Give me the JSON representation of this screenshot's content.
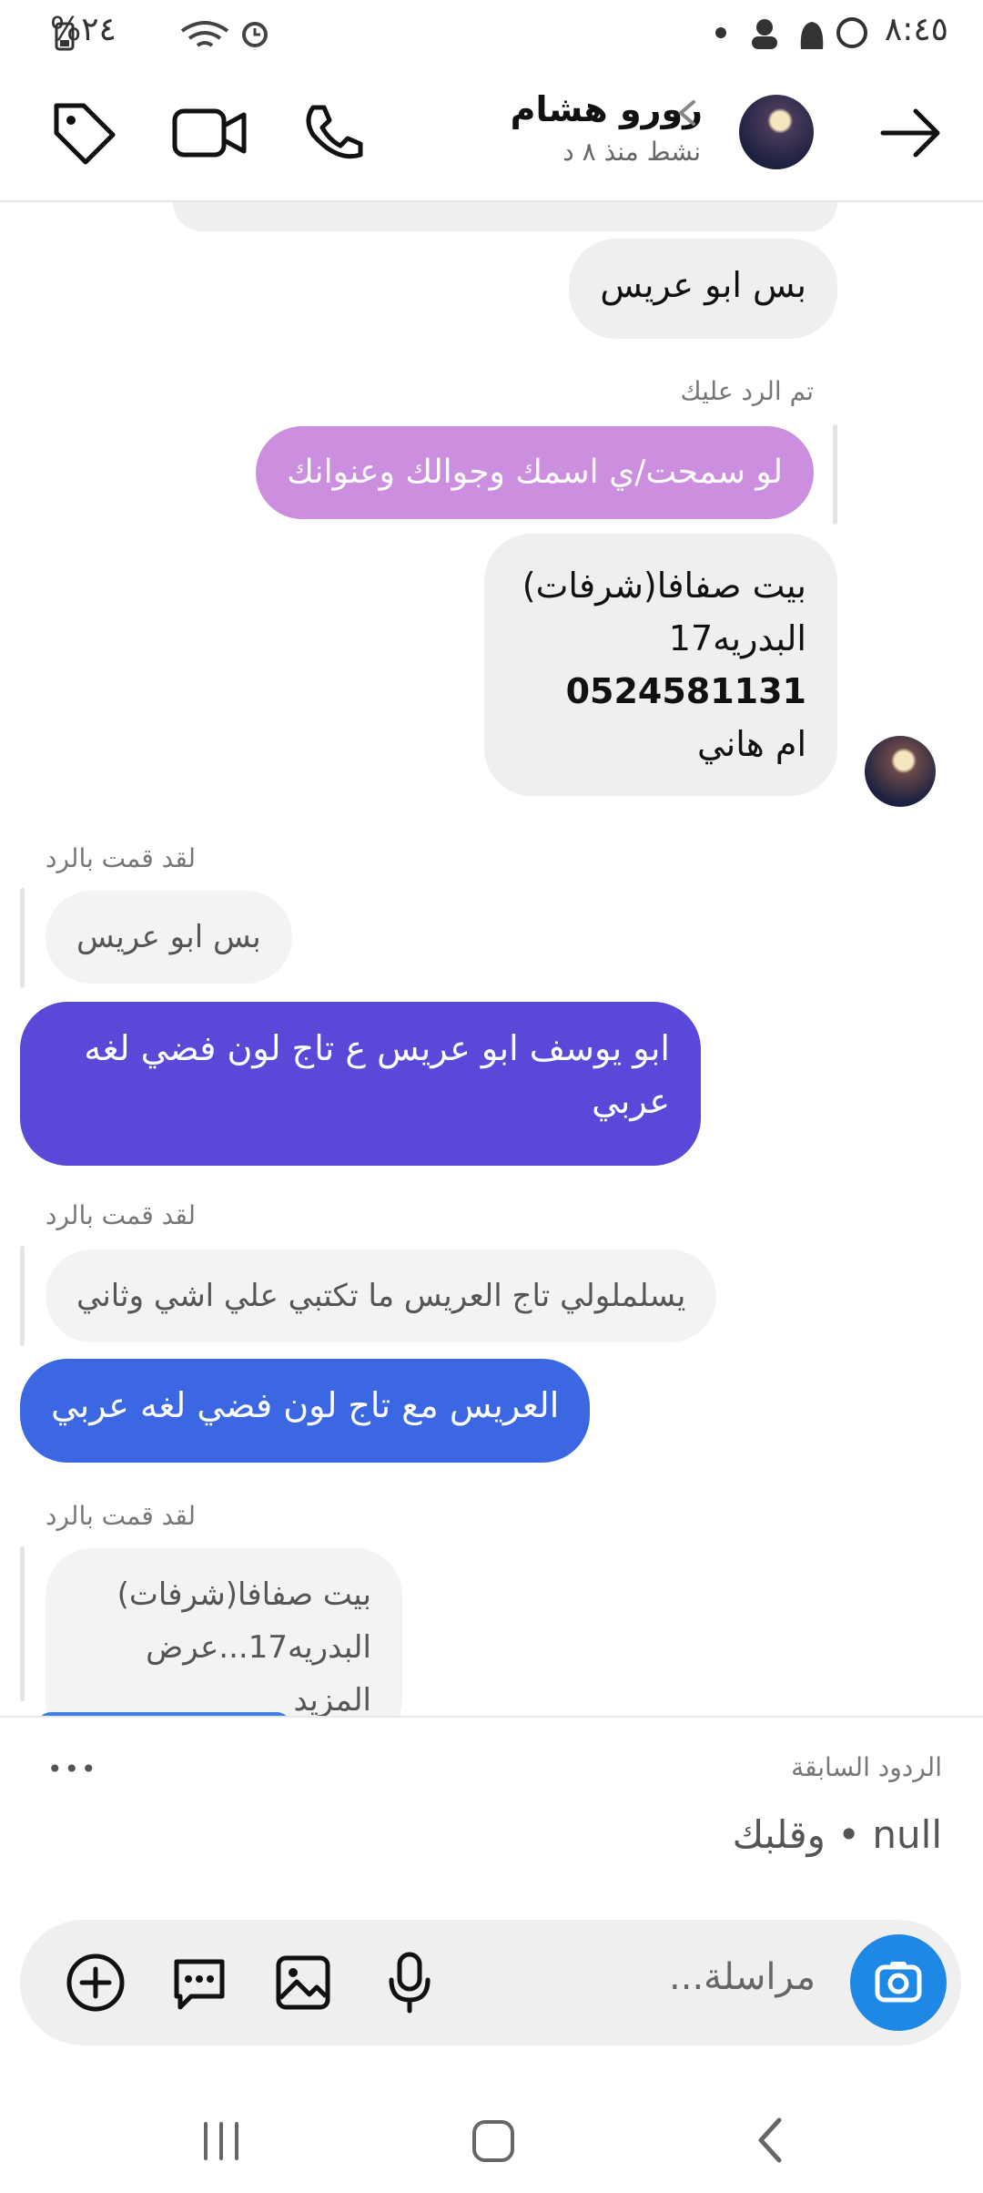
{
  "status_bar": {
    "time": "٨:٤٥",
    "battery": "%٢٤"
  },
  "header": {
    "name": "رورو هشام",
    "activity": "نشط منذ ٨ د",
    "icons": [
      "back-arrow-icon",
      "avatar",
      "chevron-icon",
      "phone-icon",
      "video-icon",
      "tag-icon"
    ]
  },
  "messages": {
    "m1": "بس ابو عريس",
    "replied_to_you": "تم الرد عليك",
    "m2_pink": "لو سمحت/ي اسمك وجوالك وعنوانك",
    "m3_lines": [
      "بيت صفافا(شرفات)",
      "البدريه17",
      "0524581131",
      "ام هاني"
    ],
    "you_replied_1": "لقد قمت بالرد",
    "quote1": "بس ابو عريس",
    "m4": "ابو يوسف  ابو عريس ع تاج  لون فضي لغه عربي",
    "you_replied_2": "لقد قمت بالرد",
    "quote2": "يسلملولي تاج العريس ما تكتبي علي اشي  وثاني",
    "m5": "العريس مع تاج لون فضي لغه عربي",
    "you_replied_3": "لقد قمت بالرد",
    "quote3_line1": "بيت صفافا(شرفات)",
    "quote3_line2": "البدريه17...عرض المزيد"
  },
  "composer": {
    "previous_replies_title": "الردود السابقة",
    "previous_reply": "null • وقلبك",
    "more": "•••",
    "placeholder": "مراسلة..."
  },
  "colors": {
    "pink": "#cc8fdf",
    "purple": "#5a48d8",
    "blue": "#3b67e3",
    "camera": "#1e88e5",
    "grey_bubble": "#efefef"
  }
}
